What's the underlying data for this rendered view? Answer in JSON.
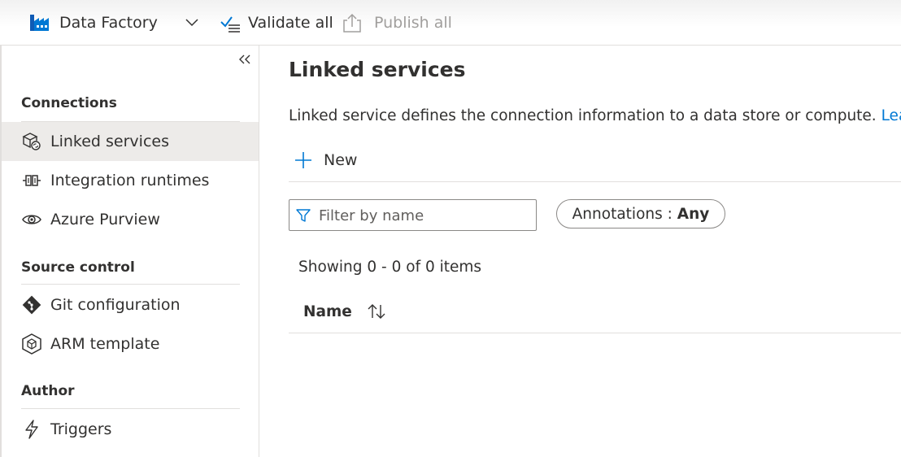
{
  "toolbar": {
    "factory_label": "Data Factory",
    "validate_label": "Validate all",
    "publish_label": "Publish all"
  },
  "sidebar": {
    "sections": [
      {
        "title": "Connections",
        "items": [
          {
            "label": "Linked services",
            "icon": "linked-services-icon",
            "selected": true
          },
          {
            "label": "Integration runtimes",
            "icon": "integration-runtime-icon"
          },
          {
            "label": "Azure Purview",
            "icon": "eye-icon"
          }
        ]
      },
      {
        "title": "Source control",
        "items": [
          {
            "label": "Git configuration",
            "icon": "git-icon"
          },
          {
            "label": "ARM template",
            "icon": "cube-icon"
          }
        ]
      },
      {
        "title": "Author",
        "items": [
          {
            "label": "Triggers",
            "icon": "lightning-icon"
          }
        ]
      }
    ]
  },
  "main": {
    "title": "Linked services",
    "description": "Linked service defines the connection information to a data store or compute.",
    "learn_more": "Learn more",
    "new_label": "New",
    "filter": {
      "placeholder": "Filter by name",
      "value": ""
    },
    "annotations": {
      "label": "Annotations :",
      "value": "Any"
    },
    "showing": "Showing 0 - 0 of 0 items",
    "table": {
      "columns": [
        "Name"
      ],
      "rows": []
    }
  },
  "colors": {
    "accent": "#0078d4",
    "selected_bg": "#edebe9",
    "text": "#323130",
    "disabled_text": "#a19f9d"
  }
}
